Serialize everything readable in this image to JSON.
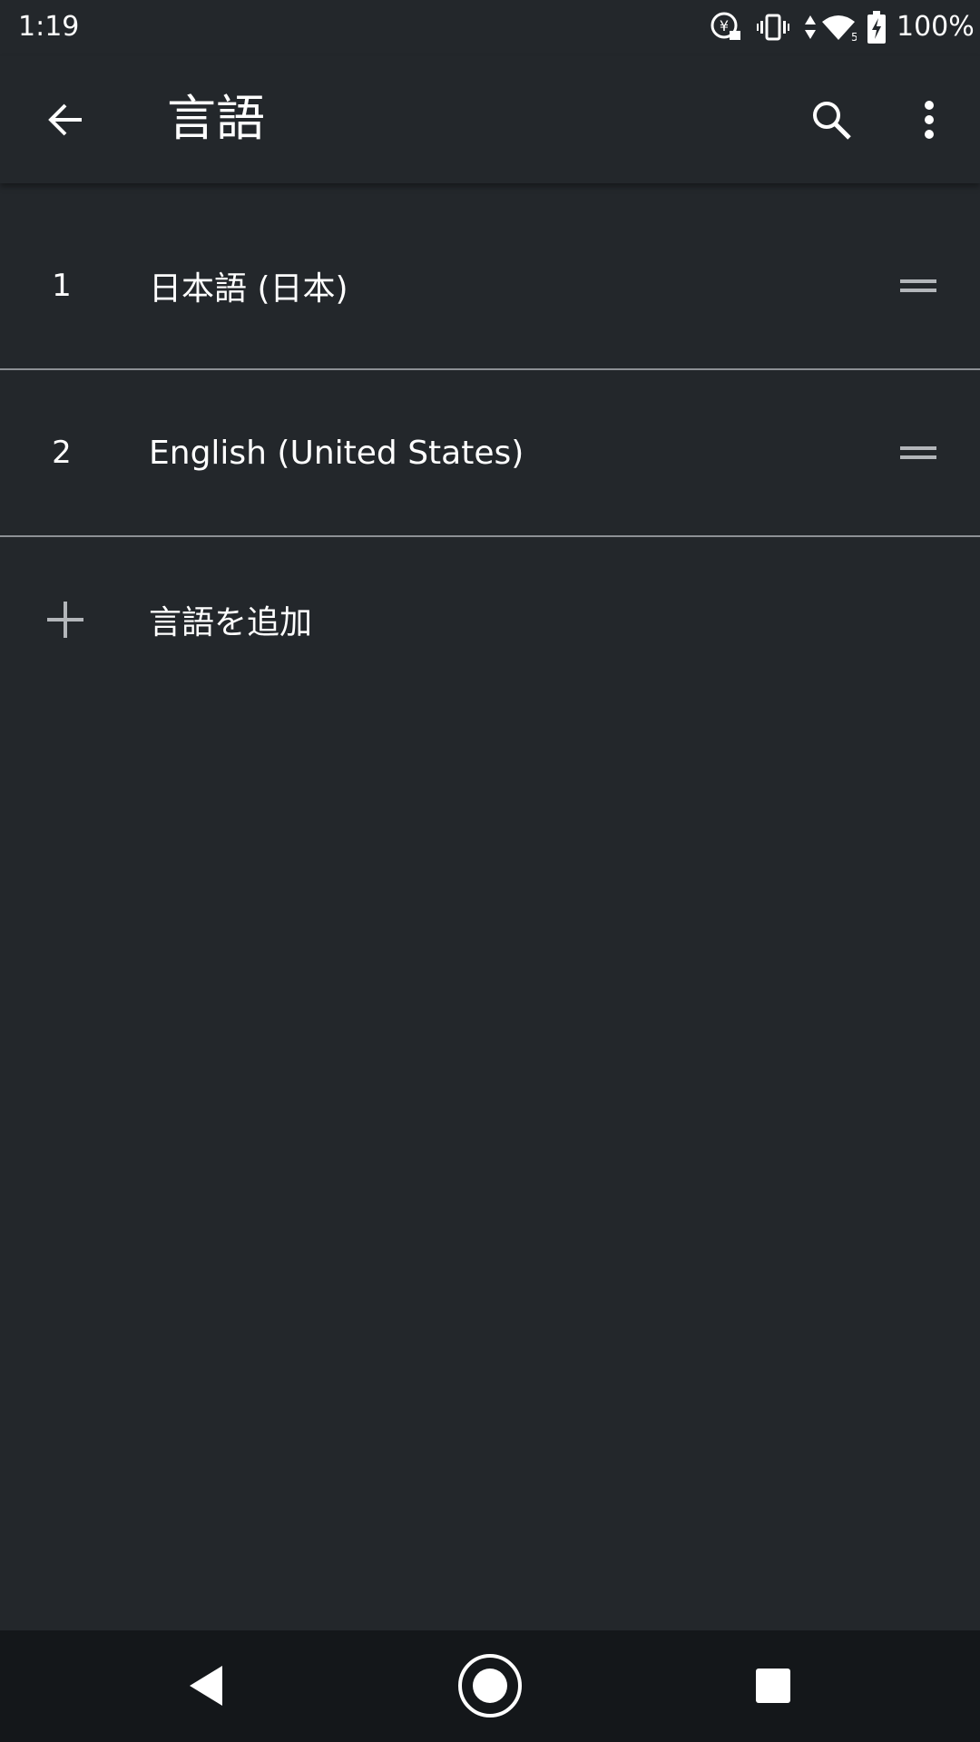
{
  "status_bar": {
    "time": "1:19",
    "battery_percent": "100%",
    "icons": [
      "data-saver-icon",
      "vibrate-icon",
      "data-transfer-icon",
      "wifi-icon",
      "battery-charging-icon"
    ],
    "wifi_badge": "5"
  },
  "app_bar": {
    "title": "言語",
    "back_icon": "arrow-back-icon",
    "search_icon": "search-icon",
    "more_icon": "more-vert-icon"
  },
  "languages": [
    {
      "order": "1",
      "label": "日本語 (日本)"
    },
    {
      "order": "2",
      "label": "English (United States)"
    }
  ],
  "add_language": {
    "label": "言語を追加",
    "icon": "plus-icon"
  },
  "nav_bar": {
    "icons": [
      "nav-back-icon",
      "nav-home-icon",
      "nav-recents-icon"
    ]
  },
  "colors": {
    "background": "#23272b",
    "divider": "#8d9095",
    "nav_background": "#14171a",
    "text": "#ffffff",
    "icon_gray": "#b3b6ba"
  }
}
